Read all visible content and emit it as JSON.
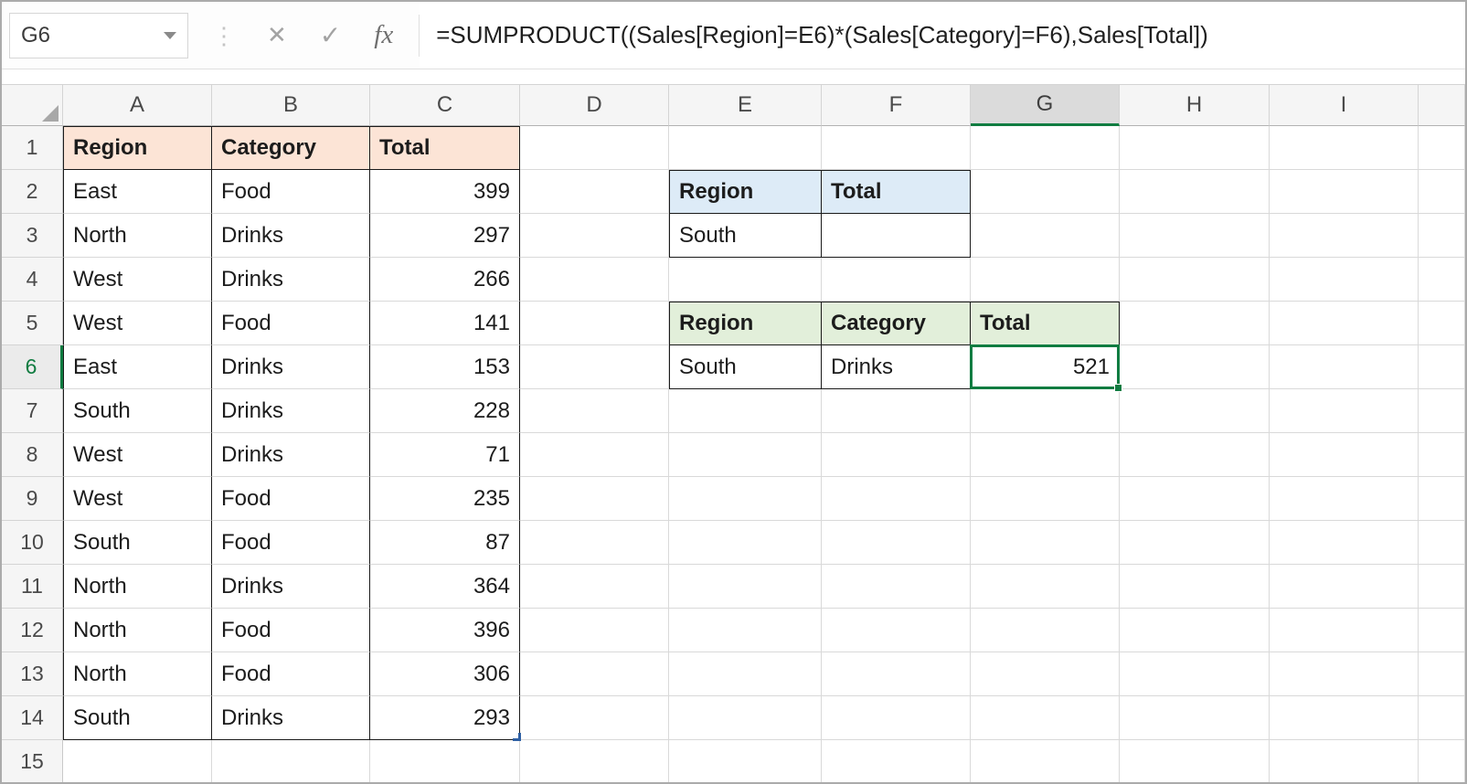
{
  "formula_bar": {
    "name_box": "G6",
    "cancel_label": "✕",
    "enter_label": "✓",
    "fx_label": "fx",
    "formula": "=SUMPRODUCT((Sales[Region]=E6)*(Sales[Category]=F6),Sales[Total])"
  },
  "grid": {
    "columns": [
      "A",
      "B",
      "C",
      "D",
      "E",
      "F",
      "G",
      "H",
      "I"
    ],
    "rows": [
      "1",
      "2",
      "3",
      "4",
      "5",
      "6",
      "7",
      "8",
      "9",
      "10",
      "11",
      "12",
      "13",
      "14",
      "15"
    ]
  },
  "selection": {
    "cell": "G6",
    "column": "G",
    "row": "6",
    "value": "521"
  },
  "tables": {
    "sales": {
      "anchor": "A1",
      "headers": [
        "Region",
        "Category",
        "Total"
      ],
      "rows": [
        [
          "East",
          "Food",
          "399"
        ],
        [
          "North",
          "Drinks",
          "297"
        ],
        [
          "West",
          "Drinks",
          "266"
        ],
        [
          "West",
          "Food",
          "141"
        ],
        [
          "East",
          "Drinks",
          "153"
        ],
        [
          "South",
          "Drinks",
          "228"
        ],
        [
          "West",
          "Drinks",
          "71"
        ],
        [
          "West",
          "Food",
          "235"
        ],
        [
          "South",
          "Food",
          "87"
        ],
        [
          "North",
          "Drinks",
          "364"
        ],
        [
          "North",
          "Food",
          "396"
        ],
        [
          "North",
          "Food",
          "306"
        ],
        [
          "South",
          "Drinks",
          "293"
        ]
      ],
      "header_fill": "#FCE4D6"
    },
    "criteria_single": {
      "anchor": "E2",
      "headers": [
        "Region",
        "Total"
      ],
      "rows": [
        [
          "South",
          ""
        ]
      ],
      "header_fill": "#DDEBF7"
    },
    "criteria_double": {
      "anchor": "E5",
      "headers": [
        "Region",
        "Category",
        "Total"
      ],
      "rows": [
        [
          "South",
          "Drinks",
          "521"
        ]
      ],
      "header_fill": "#E2EFDA"
    }
  },
  "colors": {
    "selection_green": "#107C41",
    "table_border": "#1a1a1a",
    "gridline": "#D9D9D9",
    "resize_handle_blue": "#2E5FA3",
    "sales_header_fill": "#FCE4D6",
    "blue_header_fill": "#DDEBF7",
    "green_header_fill": "#E2EFDA"
  }
}
